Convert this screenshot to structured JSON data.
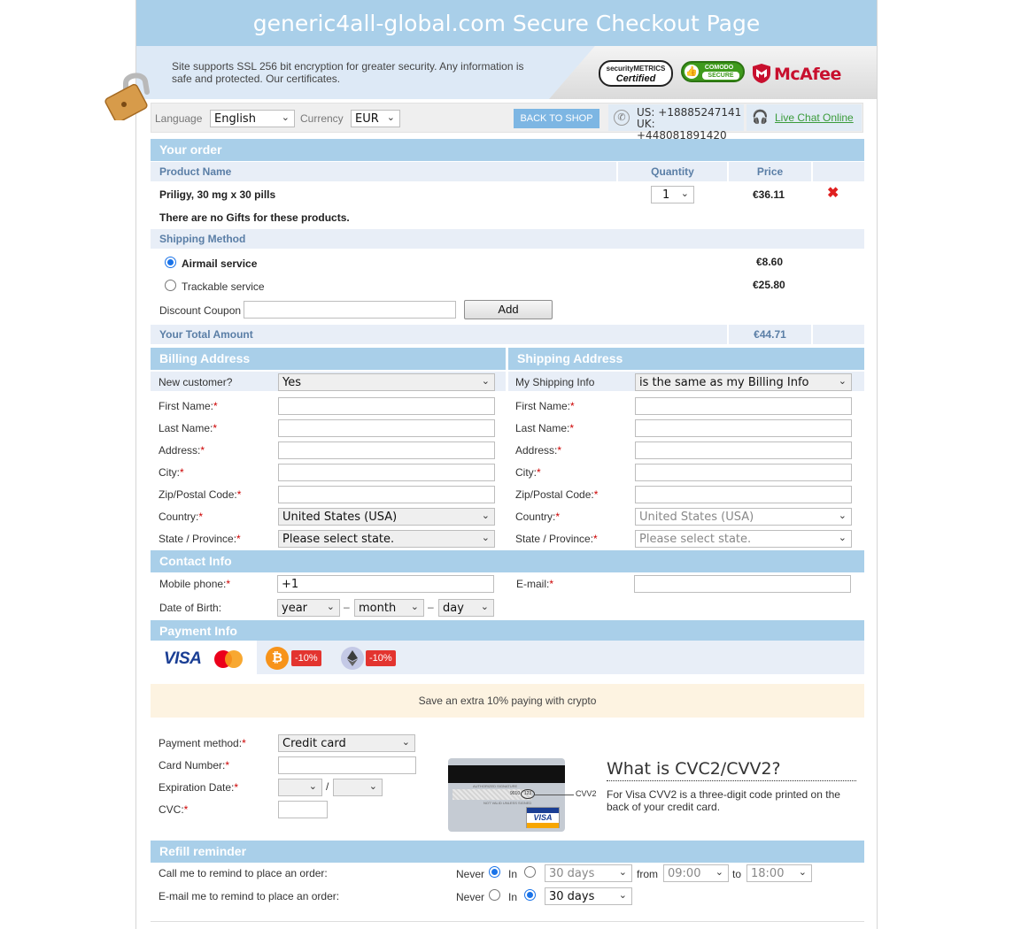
{
  "page_title": "generic4all-global.com Secure Checkout Page",
  "secure_text": "Site supports SSL 256 bit encryption for greater security. Any information is safe and protected. Our certificates.",
  "badges": {
    "securitymetrics_top": "securityMETRICS",
    "securitymetrics_bottom": "Certified",
    "comodo_top": "COMODO",
    "comodo_bottom": "SECURE",
    "mcafee": "McAfee"
  },
  "toolbar": {
    "language_label": "Language",
    "language_value": "English",
    "currency_label": "Currency",
    "currency_value": "EUR",
    "back_to_shop": "BACK TO SHOP",
    "phone_us": "US:  +18885247141",
    "phone_uk": "UK: +448081891420",
    "live_chat": "Live Chat Online"
  },
  "order": {
    "heading": "Your order",
    "col_product": "Product Name",
    "col_quantity": "Quantity",
    "col_price": "Price",
    "product_name": "Priligy, 30 mg x 30 pills",
    "quantity": "1",
    "price": "€36.11",
    "no_gifts": "There are no Gifts for these products.",
    "shipping_method_label": "Shipping Method",
    "shipping_options": [
      {
        "label": "Airmail service",
        "price": "€8.60",
        "selected": true
      },
      {
        "label": "Trackable service",
        "price": "€25.80",
        "selected": false
      }
    ],
    "discount_label": "Discount Coupon",
    "discount_placeholder": "",
    "add_button": "Add",
    "total_label": "Your Total Amount",
    "total_value": "€44.71"
  },
  "billing": {
    "heading": "Billing Address",
    "new_customer_label": "New customer?",
    "new_customer_value": "Yes",
    "first_name": "First Name:",
    "last_name": "Last Name:",
    "address": "Address:",
    "city": "City:",
    "zip": "Zip/Postal Code:",
    "country": "Country:",
    "country_value": "United States (USA)",
    "state": "State / Province:",
    "state_value": "Please select state."
  },
  "shipping": {
    "heading": "Shipping Address",
    "my_shipping_label": "My Shipping Info",
    "my_shipping_value": "is the same as my Billing Info",
    "first_name": "First Name:",
    "last_name": "Last Name:",
    "address": "Address:",
    "city": "City:",
    "zip": "Zip/Postal Code:",
    "country": "Country:",
    "country_value": "United States (USA)",
    "state": "State / Province:",
    "state_value": "Please select state."
  },
  "contact": {
    "heading": "Contact Info",
    "mobile_label": "Mobile phone:",
    "mobile_value": "+1",
    "email_label": "E-mail:",
    "dob_label": "Date of Birth:",
    "dob_year": "year",
    "dob_month": "month",
    "dob_day": "day",
    "dob_sep": "–"
  },
  "payment": {
    "heading": "Payment Info",
    "visa": "VISA",
    "btc_discount": "-10%",
    "eth_discount": "-10%",
    "crypto_banner": "Save an extra 10% paying with crypto",
    "method_label": "Payment method:",
    "method_value": "Credit card",
    "card_number_label": "Card Number:",
    "expiration_label": "Expiration Date:",
    "expiration_sep": "/",
    "cvc_label": "CVC:",
    "card_cvv_tag": "CVV2",
    "card_signature": "AUTHORIZED SIGNATURE",
    "card_not_valid": "NOT VALID UNLESS SIGNED",
    "card_digits": "9010",
    "card_cvv_digits": "123",
    "cvv_title": "What is CVC2/CVV2?",
    "cvv_text": "For Visa CVV2 is a three-digit code printed on the back of your credit card."
  },
  "refill": {
    "heading": "Refill reminder",
    "call_label": "Call me to remind to place an order:",
    "email_label": "E-mail me to remind to place an order:",
    "never": "Never",
    "in": "In",
    "days_value": "30 days",
    "from": "from",
    "from_value": "09:00",
    "to": "to",
    "to_value": "18:00"
  },
  "required_mark": "*",
  "colors": {
    "header_blue": "#a9cfe9",
    "sub_blue_bg": "#e8eef7",
    "accent_red": "#e3342f",
    "chat_green": "#3a9b3a"
  }
}
